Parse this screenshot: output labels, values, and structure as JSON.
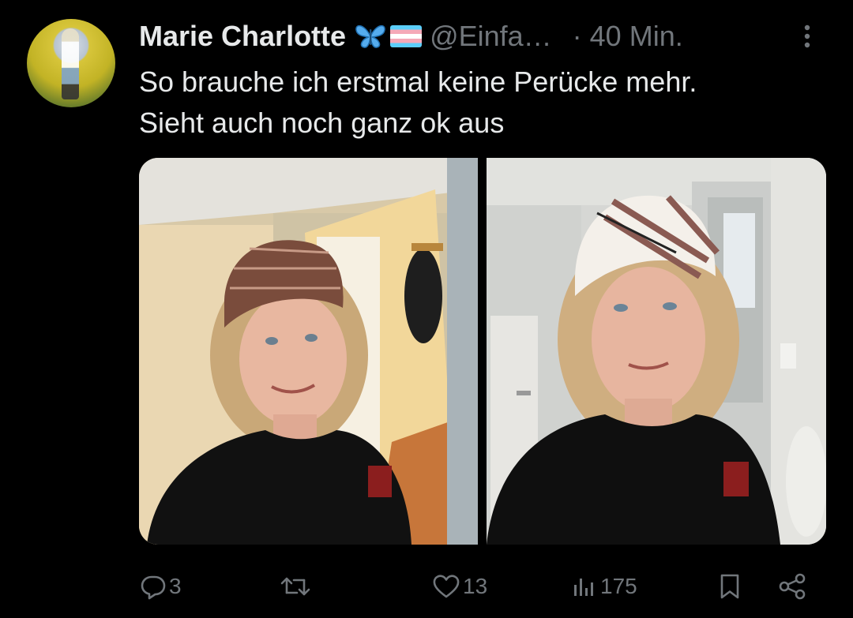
{
  "tweet": {
    "author_name": "Marie Charlotte",
    "handle": "@Einfa…",
    "time": "· 40 Min.",
    "emojis": [
      "butterfly-emoji",
      "transgender-flag-emoji"
    ],
    "text_lines": [
      "So brauche ich erstmal keine Perücke mehr.",
      "Sieht auch noch ganz ok aus"
    ],
    "media": [
      {
        "name": "photo-1",
        "content": "selfie-brown-patterned-headscarf"
      },
      {
        "name": "photo-2",
        "content": "selfie-white-patterned-headscarf"
      }
    ]
  },
  "actions": {
    "reply_count": "3",
    "retweet_count": "",
    "like_count": "13",
    "views_count": "175"
  },
  "icons": {
    "reply": "reply-icon",
    "retweet": "retweet-icon",
    "like": "heart-icon",
    "views": "views-icon",
    "bookmark": "bookmark-icon",
    "share": "share-icon",
    "more": "more-icon"
  },
  "colors": {
    "background": "#000000",
    "text": "#e7e9ea",
    "muted": "#71767b"
  }
}
